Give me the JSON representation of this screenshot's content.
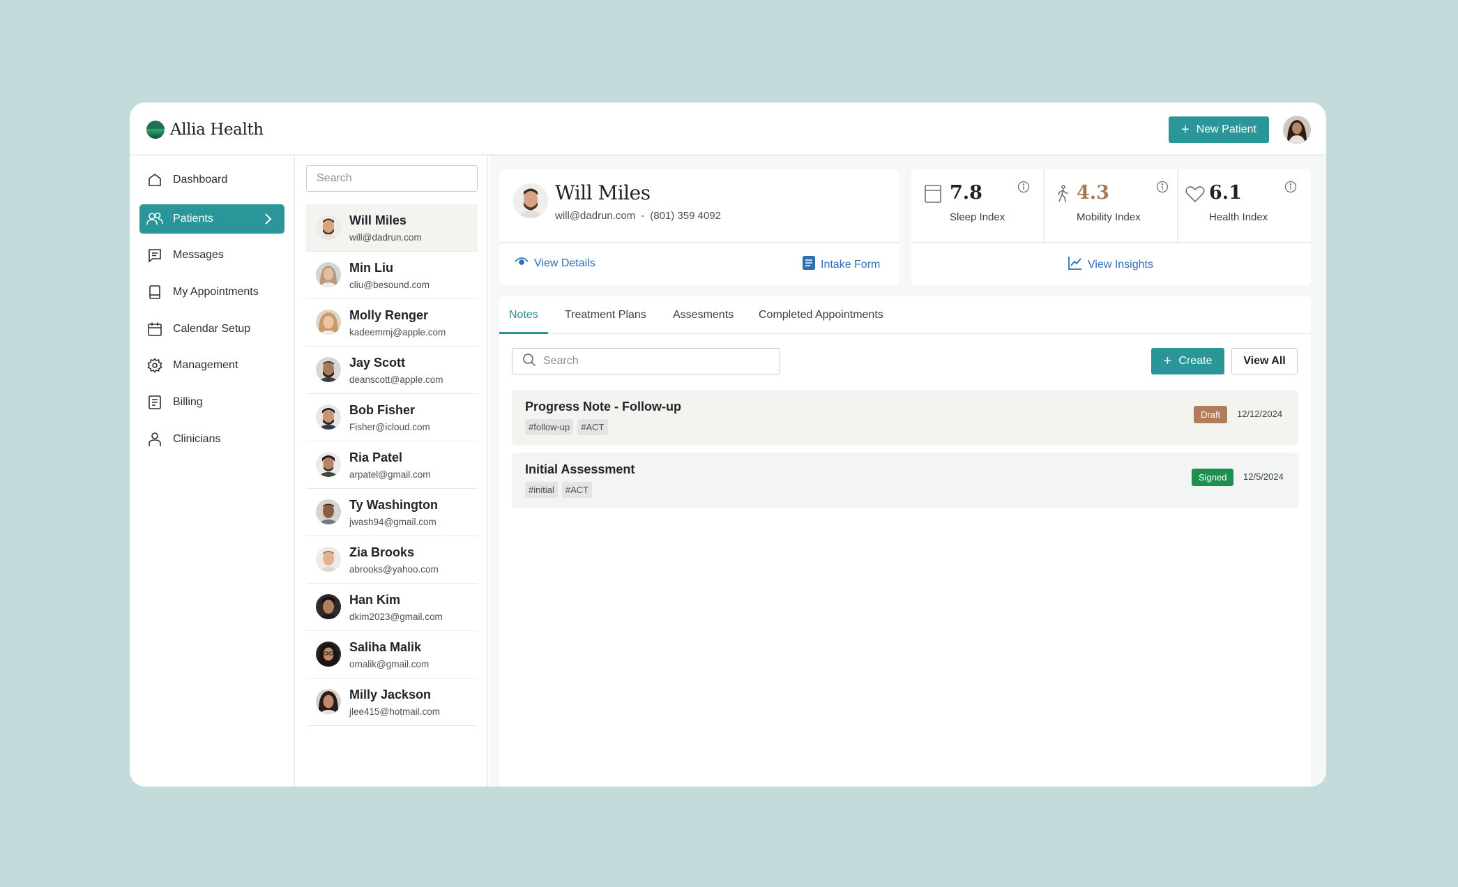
{
  "app": {
    "name": "Allia Health"
  },
  "header": {
    "new_patient_label": "New Patient"
  },
  "sidebar": {
    "items": [
      {
        "label": "Dashboard",
        "icon": "home-icon"
      },
      {
        "label": "Patients",
        "icon": "users-icon",
        "active": true
      },
      {
        "label": "Messages",
        "icon": "message-icon"
      },
      {
        "label": "My Appointments",
        "icon": "book-icon"
      },
      {
        "label": "Calendar Setup",
        "icon": "calendar-icon"
      },
      {
        "label": "Management",
        "icon": "gear-icon"
      },
      {
        "label": "Billing",
        "icon": "document-icon"
      },
      {
        "label": "Clinicians",
        "icon": "person-icon"
      }
    ]
  },
  "patient_list": {
    "search_placeholder": "Search",
    "patients": [
      {
        "name": "Will Miles",
        "email": "will@dadrun.com",
        "selected": true
      },
      {
        "name": "Min Liu",
        "email": "cliu@besound.com"
      },
      {
        "name": "Molly Renger",
        "email": "kadeemmj@apple.com"
      },
      {
        "name": "Jay Scott",
        "email": "deanscott@apple.com"
      },
      {
        "name": "Bob Fisher",
        "email": "Fisher@icloud.com"
      },
      {
        "name": "Ria Patel",
        "email": "arpatel@gmail.com"
      },
      {
        "name": "Ty Washington",
        "email": "jwash94@gmail.com"
      },
      {
        "name": "Zia Brooks",
        "email": "abrooks@yahoo.com"
      },
      {
        "name": "Han Kim",
        "email": "dkim2023@gmail.com"
      },
      {
        "name": "Saliha Malik",
        "email": "omalik@gmail.com"
      },
      {
        "name": "Milly Jackson",
        "email": "jlee415@hotmail.com"
      }
    ]
  },
  "patient": {
    "name": "Will Miles",
    "email": "will@dadrun.com",
    "separator": "-",
    "phone": "(801) 359 4092",
    "view_details_label": "View Details",
    "intake_form_label": "Intake Form"
  },
  "insights": {
    "sleep": {
      "value": "7.8",
      "label": "Sleep Index",
      "color": "#1f2328"
    },
    "mobility": {
      "value": "4.3",
      "label": "Mobility Index",
      "color": "#a77a55"
    },
    "health": {
      "value": "6.1",
      "label": "Health Index",
      "color": "#1f2328"
    },
    "view_insights_label": "View Insights"
  },
  "tabs": [
    {
      "label": "Notes",
      "active": true
    },
    {
      "label": "Treatment Plans"
    },
    {
      "label": "Assesments"
    },
    {
      "label": "Completed Appointments"
    }
  ],
  "notes_toolbar": {
    "search_placeholder": "Search",
    "create_label": "Create",
    "view_all_label": "View All"
  },
  "notes": [
    {
      "title": "Progress Note - Follow-up",
      "tags": [
        "#follow-up",
        "#ACT"
      ],
      "status": "Draft",
      "status_color": "#b07d5c",
      "date": "12/12/2024",
      "bg": "#f5f3f0"
    },
    {
      "title": "Initial Assessment",
      "tags": [
        "#initial",
        "#ACT"
      ],
      "status": "Signed",
      "status_color": "#1e8f4e",
      "date": "12/5/2024",
      "bg": "#f3f4f4"
    }
  ],
  "colors": {
    "accent": "#2b9699",
    "link": "#2e6fb8",
    "background": "#c3dcdb"
  }
}
